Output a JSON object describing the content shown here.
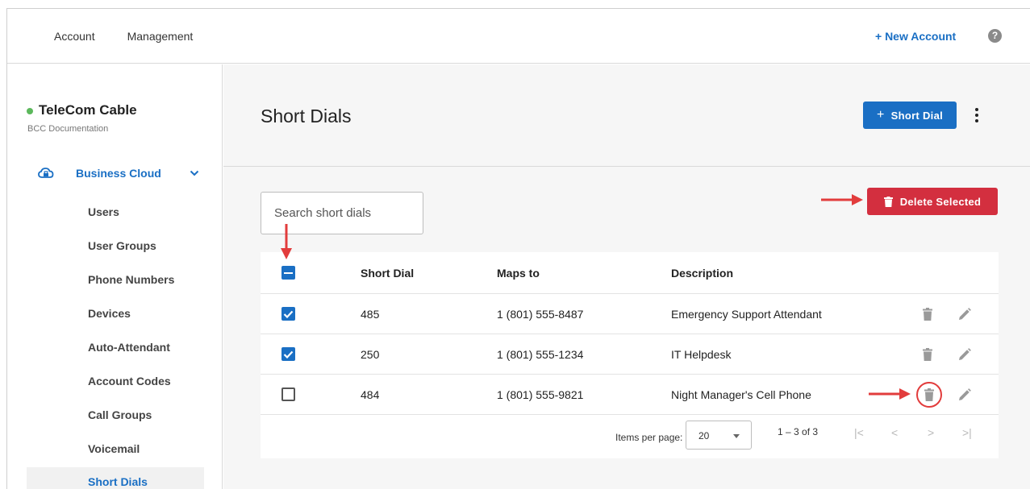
{
  "topbar": {
    "nav": [
      "Account",
      "Management"
    ],
    "new_account": "+ New Account",
    "help": "?"
  },
  "sidebar": {
    "org_name": "TeleCom Cable",
    "org_sub": "BCC Documentation",
    "section_label": "Business Cloud",
    "items": [
      {
        "label": "Users"
      },
      {
        "label": "User Groups"
      },
      {
        "label": "Phone Numbers"
      },
      {
        "label": "Devices"
      },
      {
        "label": "Auto-Attendant"
      },
      {
        "label": "Account Codes"
      },
      {
        "label": "Call Groups"
      },
      {
        "label": "Voicemail"
      },
      {
        "label": "Short Dials",
        "active": true
      }
    ]
  },
  "main": {
    "title": "Short Dials",
    "add_button": "Short Dial",
    "add_button_icon": "+",
    "search_placeholder": "Search short dials",
    "delete_selected": "Delete Selected",
    "columns": [
      "Short Dial",
      "Maps to",
      "Description"
    ],
    "rows": [
      {
        "short_dial": "485",
        "maps_to": "1 (801) 555-8487",
        "description": "Emergency Support Attendant",
        "checked": true
      },
      {
        "short_dial": "250",
        "maps_to": "1 (801) 555-1234",
        "description": "IT Helpdesk",
        "checked": true
      },
      {
        "short_dial": "484",
        "maps_to": "1 (801) 555-9821",
        "description": "Night Manager's Cell Phone",
        "checked": false
      }
    ],
    "paginator": {
      "items_per_page_label": "Items per page:",
      "items_per_page": "20",
      "range": "1 – 3 of 3",
      "first": "|<",
      "prev": "<",
      "next": ">",
      "last": ">|"
    }
  },
  "colors": {
    "accent": "#1a6fc4",
    "danger": "#d32f3f",
    "annotation": "#e23c3c",
    "status_online": "#5cb85c"
  }
}
